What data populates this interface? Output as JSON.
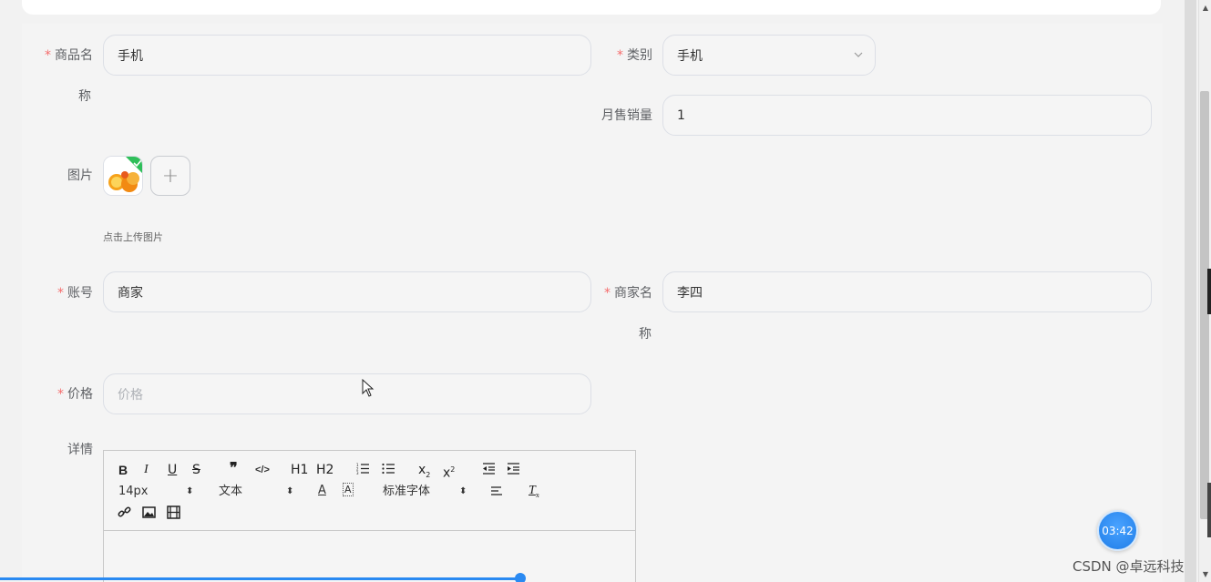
{
  "form": {
    "product_name": {
      "label": "商品名",
      "label_wrap": "称",
      "value": "手机"
    },
    "category": {
      "label": "类别",
      "value": "手机"
    },
    "monthly_sales": {
      "label": "月售销量",
      "value": "1"
    },
    "image": {
      "label": "图片",
      "hint": "点击上传图片"
    },
    "account": {
      "label": "账号",
      "value": "商家"
    },
    "merchant_name": {
      "label": "商家名",
      "label_wrap": "称",
      "value": "李四"
    },
    "price": {
      "label": "价格",
      "placeholder": "价格"
    },
    "details": {
      "label": "详情"
    }
  },
  "editor": {
    "font_size": "14px",
    "heading_type": "文本",
    "font_family": "标准字体",
    "h1": "H1",
    "h2": "H2"
  },
  "required_mark": "*",
  "timer": "03:42",
  "watermark": "CSDN @卓远科技",
  "progress": 0.43,
  "colors": {
    "accent": "#2a8af2",
    "required": "#f56c6c"
  }
}
